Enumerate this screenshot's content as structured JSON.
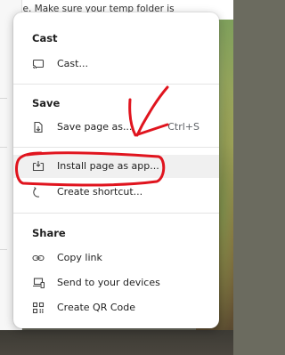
{
  "background": {
    "top_text": "file. Make sure your temp folder is"
  },
  "menu": {
    "sections": [
      {
        "title": "Cast",
        "items": [
          {
            "label": "Cast...",
            "icon": "cast-icon"
          }
        ]
      },
      {
        "title": "Save",
        "items": [
          {
            "label": "Save page as...",
            "shortcut": "Ctrl+S",
            "icon": "save-page-icon"
          },
          {
            "label": "Install page as app...",
            "icon": "install-app-icon"
          },
          {
            "label": "Create shortcut...",
            "icon": "shortcut-icon"
          }
        ]
      },
      {
        "title": "Share",
        "items": [
          {
            "label": "Copy link",
            "icon": "link-icon"
          },
          {
            "label": "Send to your devices",
            "icon": "devices-icon"
          },
          {
            "label": "Create QR Code",
            "icon": "qr-code-icon"
          }
        ]
      }
    ]
  },
  "annotation": {
    "color": "#e0141e"
  }
}
